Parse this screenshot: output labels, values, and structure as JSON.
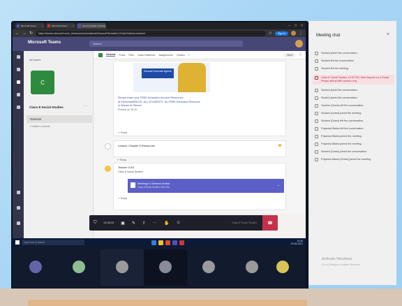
{
  "browser": {
    "tabs": [
      {
        "label": "Microsoft Teams",
        "icon": "teams-icon",
        "active": false
      },
      {
        "label": "Microsoft Stream",
        "icon": "stream-icon",
        "active": false
      },
      {
        "label": "General (Class 8 Social)",
        "icon": "teams-icon",
        "active": true
      }
    ],
    "url": "https://teams.microsoft.com/_#/school/conversations/General?threadId=19:ab12cd&ctx=channel",
    "profile_pill": "Sign in"
  },
  "teams": {
    "app_name": "Microsoft Teams",
    "search_placeholder": "Search",
    "back_label": "All teams",
    "team_tile": "C",
    "team_name": "Class 8 Social Studies",
    "channel": "General",
    "hidden_channels": "1 hidden channel",
    "channel_tabs": [
      "General",
      "Posts",
      "Files",
      "Class Notebook",
      "Assignments",
      "Grades",
      "+"
    ],
    "meet_label": "Meet",
    "card1": {
      "promo_text": "Educate Innovate Agents",
      "lines": [
        "Please share your FREE Education Account Resources",
        "at ESchoolsMIRCLE. ALL STUDENTS. No FREE Education Resource",
        "in Stream at Stream",
        "Posted on 10:20"
      ],
      "reply": "↩ Reply"
    },
    "card2": {
      "title": "Lesson: Chapter 5 Resources",
      "reply": "↩ Reply"
    },
    "card3": {
      "header1": "Teacher 10:18",
      "header2": "Class 8 Social Studies",
      "meeting_title": "Meeting in General ended",
      "meeting_sub": "Class 8 Social Studies: 45m 20s",
      "reply": "↩ Reply"
    }
  },
  "call_controls": {
    "timer": "00:45:24",
    "title": "Class 8 Social Studies"
  },
  "taskbar": {
    "search": "Type here to search",
    "clock": "10:46",
    "date": "03-08-2021"
  },
  "meeting_chat": {
    "title": "Meeting chat",
    "items": [
      {
        "icon": "join-icon",
        "text": "Student joined the conversation.",
        "highlight": false
      },
      {
        "icon": "leave-icon",
        "text": "Student left the conversation.",
        "highlight": false
      },
      {
        "icon": "leave-icon",
        "text": "Student left the meeting.",
        "highlight": false
      },
      {
        "icon": "chat-icon",
        "text": "Class 8 Social Studies: 10:51 PM. Meet Anyone so a Social, Please attend with camera only.",
        "highlight": true
      },
      {
        "icon": "join-icon",
        "text": "Student joined the conversation.",
        "highlight": false
      },
      {
        "icon": "join-icon",
        "text": "Student joined the conversation.",
        "highlight": false
      },
      {
        "icon": "join-icon",
        "text": "Teacher (Guest) left the conversation.",
        "highlight": false
      },
      {
        "icon": "join-icon",
        "text": "Student (Guest) joined the meeting.",
        "highlight": false
      },
      {
        "icon": "join-icon",
        "text": "Student (Guest) left the conversation.",
        "highlight": false
      },
      {
        "icon": "join-icon",
        "text": "Priyanka Mishra left the conversation.",
        "highlight": false
      },
      {
        "icon": "leave-icon",
        "text": "Priyanka Mishra joined the meeting.",
        "highlight": false
      },
      {
        "icon": "join-icon",
        "text": "Priyanka Mishra joined the meeting.",
        "highlight": false
      },
      {
        "icon": "leave-icon",
        "text": "Student (Guest) joined the conversation.",
        "highlight": false
      },
      {
        "icon": "leave-icon",
        "text": "Priyanka Mishra (Guest) joined the meeting.",
        "highlight": false
      }
    ],
    "activate_title": "Activate Windows",
    "activate_sub": "Go to Settings to activate Windows."
  },
  "participants": [
    {
      "initials": "",
      "color": "#6264a7"
    },
    {
      "initials": "",
      "color": "#8fbf8f"
    },
    {
      "initials": "",
      "color": "#9a9a9a"
    },
    {
      "initials": "",
      "color": "#8a8a9a"
    },
    {
      "initials": "",
      "color": "#9a9a9a"
    },
    {
      "initials": "",
      "color": "#9a9a9a"
    },
    {
      "initials": "",
      "color": "#d8c25a"
    }
  ],
  "colors": {
    "teams_purple": "#464775",
    "accent": "#5b5fc7",
    "hangup": "#c4314b"
  }
}
